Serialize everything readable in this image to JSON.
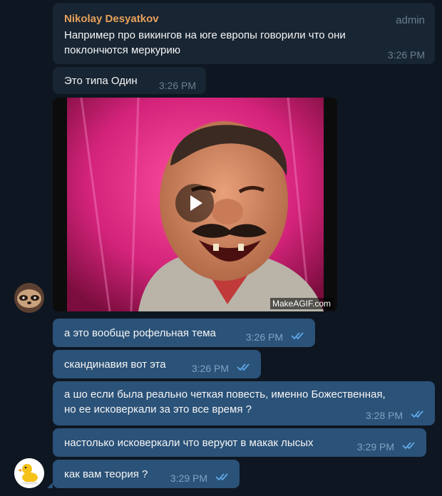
{
  "messages": {
    "m1": {
      "sender": "Nikolay Desyatkov",
      "role": "admin",
      "text_line1": "Например про викингов на юге европы говорили что они",
      "text_line2": "поклончются меркурию",
      "time": "3:26 PM"
    },
    "m2": {
      "text": "Это типа Один",
      "time": "3:26 PM"
    },
    "gif": {
      "watermark": "MakeAGIF.com"
    },
    "m3": {
      "text": "а это вообще рофельная тема",
      "time": "3:26 PM"
    },
    "m4": {
      "text": "скандинавия вот эта",
      "time": "3:26 PM"
    },
    "m5": {
      "text_line1": "а шо если была реально четкая повесть, именно Божественная,",
      "text_line2": "но ее исковеркали за это все время ?",
      "time": "3:28 PM"
    },
    "m6": {
      "text": "настолько исковеркали что веруют в макак лысых",
      "time": "3:29 PM"
    },
    "m7": {
      "text": "как вам теория ?",
      "time": "3:29 PM"
    }
  },
  "colors": {
    "background": "#0e1621",
    "incoming_bubble": "#182533",
    "outgoing_bubble": "#2b5278",
    "sender_name": "#e8a05a",
    "read_ticks": "#5fa8e8"
  },
  "icons": [
    "play-icon",
    "double-check-icon",
    "duck-avatar-icon",
    "user-avatar"
  ]
}
